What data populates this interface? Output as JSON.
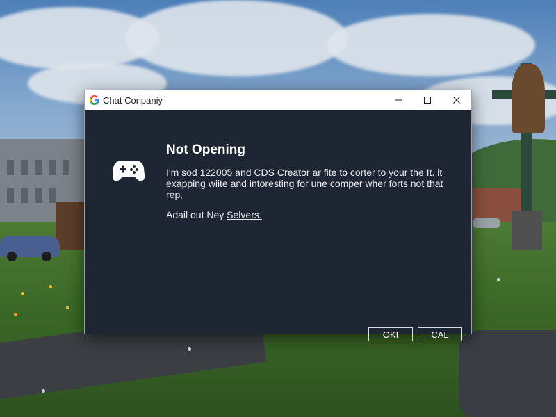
{
  "window": {
    "title": "Chat Conpaniy",
    "app_icon": "google-g-logo",
    "controls": [
      "minimize-icon",
      "maximize-icon",
      "close-icon"
    ]
  },
  "dialog": {
    "icon": "gamepad-icon",
    "heading": "Not Opening",
    "message": "I'm sod 122005 and CDS Creator ar fite to corter to your the It. it exapping wiite and intoresting for une comper wher forts not that rep.",
    "link_prefix": "Adail out Ney ",
    "link_text": "Selvers.",
    "buttons": {
      "ok": "OKI",
      "cancel": "CAL"
    }
  },
  "colors": {
    "dialog_background": "#1f2633",
    "titlebar_background": "#ffffff",
    "text": "#ffffff"
  }
}
